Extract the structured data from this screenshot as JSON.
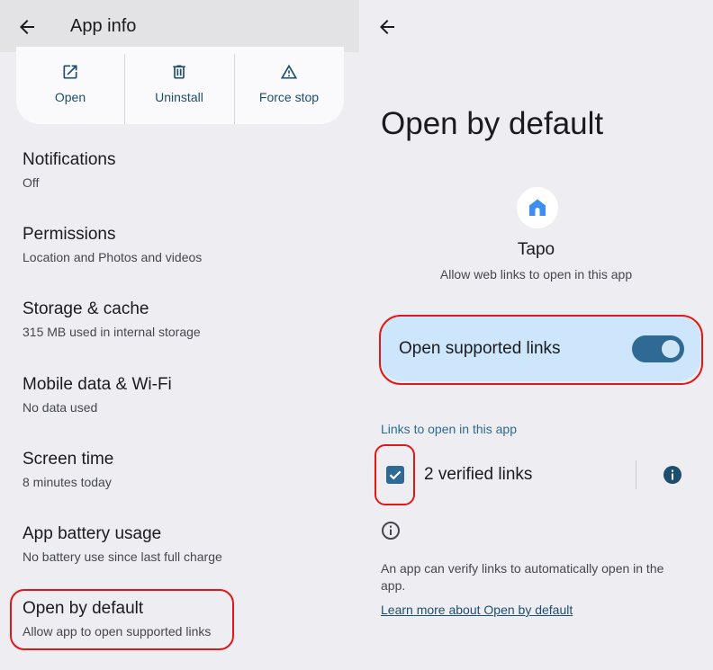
{
  "left": {
    "header": {
      "title": "App info"
    },
    "actions": [
      {
        "label": "Open",
        "icon": "open-external-icon"
      },
      {
        "label": "Uninstall",
        "icon": "trash-icon"
      },
      {
        "label": "Force stop",
        "icon": "warning-icon"
      }
    ],
    "items": [
      {
        "title": "Notifications",
        "subtitle": "Off"
      },
      {
        "title": "Permissions",
        "subtitle": "Location and Photos and videos"
      },
      {
        "title": "Storage & cache",
        "subtitle": "315 MB used in internal storage"
      },
      {
        "title": "Mobile data & Wi-Fi",
        "subtitle": "No data used"
      },
      {
        "title": "Screen time",
        "subtitle": "8 minutes today"
      },
      {
        "title": "App battery usage",
        "subtitle": "No battery use since last full charge"
      },
      {
        "title": "Open by default",
        "subtitle": "Allow app to open supported links"
      }
    ]
  },
  "right": {
    "title": "Open by default",
    "app": {
      "name": "Tapo",
      "subtitle": "Allow web links to open in this app",
      "icon": "tapo-home-icon"
    },
    "open_supported_links": {
      "label": "Open supported links",
      "enabled": true
    },
    "links_section": {
      "header": "Links to open in this app",
      "verified_label": "2 verified links",
      "checked": true
    },
    "footer": {
      "description": "An app can verify links to automatically open in the app.",
      "learn_more": "Learn more about Open by default"
    }
  },
  "colors": {
    "accent": "#2e6a93",
    "highlight": "#e01818",
    "card": "#cde6fb"
  }
}
